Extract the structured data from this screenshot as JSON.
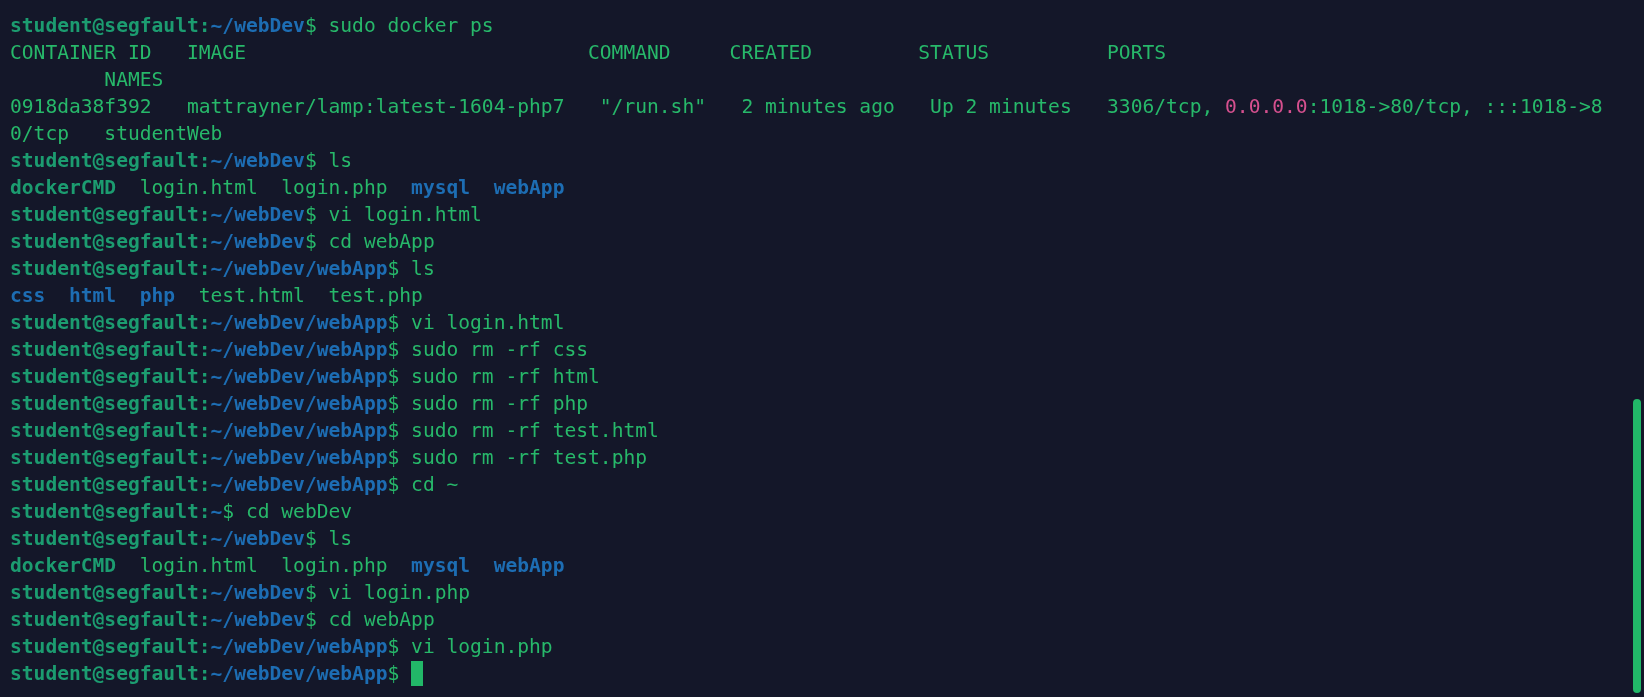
{
  "terminal": {
    "lines": [
      {
        "cursor": false,
        "segments": [
          {
            "kind": "user",
            "text": "student@segfault:"
          },
          {
            "kind": "path",
            "text": "~/webDev"
          },
          {
            "kind": "plain",
            "text": "$ sudo docker ps"
          }
        ]
      },
      {
        "cursor": false,
        "segments": [
          {
            "kind": "plain",
            "text": "CONTAINER ID   IMAGE                             COMMAND     CREATED         STATUS          PORTS"
          }
        ]
      },
      {
        "cursor": false,
        "segments": [
          {
            "kind": "plain",
            "text": "        NAMES"
          }
        ]
      },
      {
        "cursor": false,
        "segments": [
          {
            "kind": "plain",
            "text": "0918da38f392   mattrayner/lamp:latest-1604-php7   \"/run.sh\"   2 minutes ago   Up 2 minutes   3306/tcp, "
          },
          {
            "kind": "address",
            "text": "0.0.0.0"
          },
          {
            "kind": "plain",
            "text": ":1018->80/tcp, :::1018->8"
          }
        ]
      },
      {
        "cursor": false,
        "segments": [
          {
            "kind": "plain",
            "text": "0/tcp   studentWeb"
          }
        ]
      },
      {
        "cursor": false,
        "segments": [
          {
            "kind": "user",
            "text": "student@segfault:"
          },
          {
            "kind": "path",
            "text": "~/webDev"
          },
          {
            "kind": "plain",
            "text": "$ ls"
          }
        ]
      },
      {
        "cursor": false,
        "segments": [
          {
            "kind": "executable",
            "text": "dockerCMD"
          },
          {
            "kind": "plain",
            "text": "  login.html  login.php  "
          },
          {
            "kind": "directory",
            "text": "mysql  "
          },
          {
            "kind": "directory",
            "text": "webApp"
          }
        ]
      },
      {
        "cursor": false,
        "segments": [
          {
            "kind": "user",
            "text": "student@segfault:"
          },
          {
            "kind": "path",
            "text": "~/webDev"
          },
          {
            "kind": "plain",
            "text": "$ vi login.html"
          }
        ]
      },
      {
        "cursor": false,
        "segments": [
          {
            "kind": "user",
            "text": "student@segfault:"
          },
          {
            "kind": "path",
            "text": "~/webDev"
          },
          {
            "kind": "plain",
            "text": "$ cd webApp"
          }
        ]
      },
      {
        "cursor": false,
        "segments": [
          {
            "kind": "user",
            "text": "student@segfault:"
          },
          {
            "kind": "path",
            "text": "~/webDev/webApp"
          },
          {
            "kind": "plain",
            "text": "$ ls"
          }
        ]
      },
      {
        "cursor": false,
        "segments": [
          {
            "kind": "directory",
            "text": "css  "
          },
          {
            "kind": "directory",
            "text": "html  "
          },
          {
            "kind": "directory",
            "text": "php"
          },
          {
            "kind": "plain",
            "text": "  test.html  test.php"
          }
        ]
      },
      {
        "cursor": false,
        "segments": [
          {
            "kind": "user",
            "text": "student@segfault:"
          },
          {
            "kind": "path",
            "text": "~/webDev/webApp"
          },
          {
            "kind": "plain",
            "text": "$ vi login.html"
          }
        ]
      },
      {
        "cursor": false,
        "segments": [
          {
            "kind": "user",
            "text": "student@segfault:"
          },
          {
            "kind": "path",
            "text": "~/webDev/webApp"
          },
          {
            "kind": "plain",
            "text": "$ sudo rm -rf css"
          }
        ]
      },
      {
        "cursor": false,
        "segments": [
          {
            "kind": "user",
            "text": "student@segfault:"
          },
          {
            "kind": "path",
            "text": "~/webDev/webApp"
          },
          {
            "kind": "plain",
            "text": "$ sudo rm -rf html"
          }
        ]
      },
      {
        "cursor": false,
        "segments": [
          {
            "kind": "user",
            "text": "student@segfault:"
          },
          {
            "kind": "path",
            "text": "~/webDev/webApp"
          },
          {
            "kind": "plain",
            "text": "$ sudo rm -rf php"
          }
        ]
      },
      {
        "cursor": false,
        "segments": [
          {
            "kind": "user",
            "text": "student@segfault:"
          },
          {
            "kind": "path",
            "text": "~/webDev/webApp"
          },
          {
            "kind": "plain",
            "text": "$ sudo rm -rf test.html"
          }
        ]
      },
      {
        "cursor": false,
        "segments": [
          {
            "kind": "user",
            "text": "student@segfault:"
          },
          {
            "kind": "path",
            "text": "~/webDev/webApp"
          },
          {
            "kind": "plain",
            "text": "$ sudo rm -rf test.php"
          }
        ]
      },
      {
        "cursor": false,
        "segments": [
          {
            "kind": "user",
            "text": "student@segfault:"
          },
          {
            "kind": "path",
            "text": "~/webDev/webApp"
          },
          {
            "kind": "plain",
            "text": "$ cd ~"
          }
        ]
      },
      {
        "cursor": false,
        "segments": [
          {
            "kind": "user",
            "text": "student@segfault:"
          },
          {
            "kind": "path",
            "text": "~"
          },
          {
            "kind": "plain",
            "text": "$ cd webDev"
          }
        ]
      },
      {
        "cursor": false,
        "segments": [
          {
            "kind": "user",
            "text": "student@segfault:"
          },
          {
            "kind": "path",
            "text": "~/webDev"
          },
          {
            "kind": "plain",
            "text": "$ ls"
          }
        ]
      },
      {
        "cursor": false,
        "segments": [
          {
            "kind": "executable",
            "text": "dockerCMD"
          },
          {
            "kind": "plain",
            "text": "  login.html  login.php  "
          },
          {
            "kind": "directory",
            "text": "mysql  "
          },
          {
            "kind": "directory",
            "text": "webApp"
          }
        ]
      },
      {
        "cursor": false,
        "segments": [
          {
            "kind": "user",
            "text": "student@segfault:"
          },
          {
            "kind": "path",
            "text": "~/webDev"
          },
          {
            "kind": "plain",
            "text": "$ vi login.php"
          }
        ]
      },
      {
        "cursor": false,
        "segments": [
          {
            "kind": "user",
            "text": "student@segfault:"
          },
          {
            "kind": "path",
            "text": "~/webDev"
          },
          {
            "kind": "plain",
            "text": "$ cd webApp"
          }
        ]
      },
      {
        "cursor": false,
        "segments": [
          {
            "kind": "user",
            "text": "student@segfault:"
          },
          {
            "kind": "path",
            "text": "~/webDev/webApp"
          },
          {
            "kind": "plain",
            "text": "$ vi login.php"
          }
        ]
      },
      {
        "cursor": true,
        "segments": [
          {
            "kind": "user",
            "text": "student@segfault:"
          },
          {
            "kind": "path",
            "text": "~/webDev/webApp"
          },
          {
            "kind": "plain",
            "text": "$ "
          }
        ]
      }
    ]
  }
}
